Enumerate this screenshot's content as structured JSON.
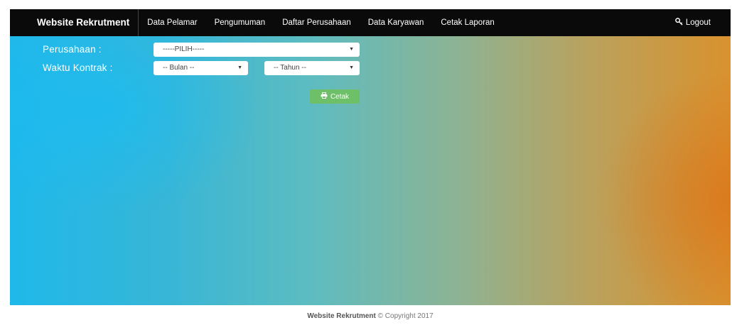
{
  "navbar": {
    "brand": "Website Rekrutment",
    "items": [
      {
        "label": "Data Pelamar"
      },
      {
        "label": "Pengumuman"
      },
      {
        "label": "Daftar Perusahaan"
      },
      {
        "label": "Data Karyawan"
      },
      {
        "label": "Cetak Laporan"
      }
    ],
    "logout_label": "Logout",
    "logout_icon": "key-icon"
  },
  "form": {
    "perusahaan_label": "Perusahaan :",
    "perusahaan_value": "-----PILIH-----",
    "waktu_label": "Waktu Kontrak :",
    "bulan_value": "-- Bulan --",
    "tahun_value": "-- Tahun --",
    "cetak_label": "Cetak",
    "cetak_icon": "print-icon",
    "cetak_color": "#6dbf68"
  },
  "footer": {
    "brand": "Website Rekrutment",
    "copyright": "© Copyright 2017"
  }
}
